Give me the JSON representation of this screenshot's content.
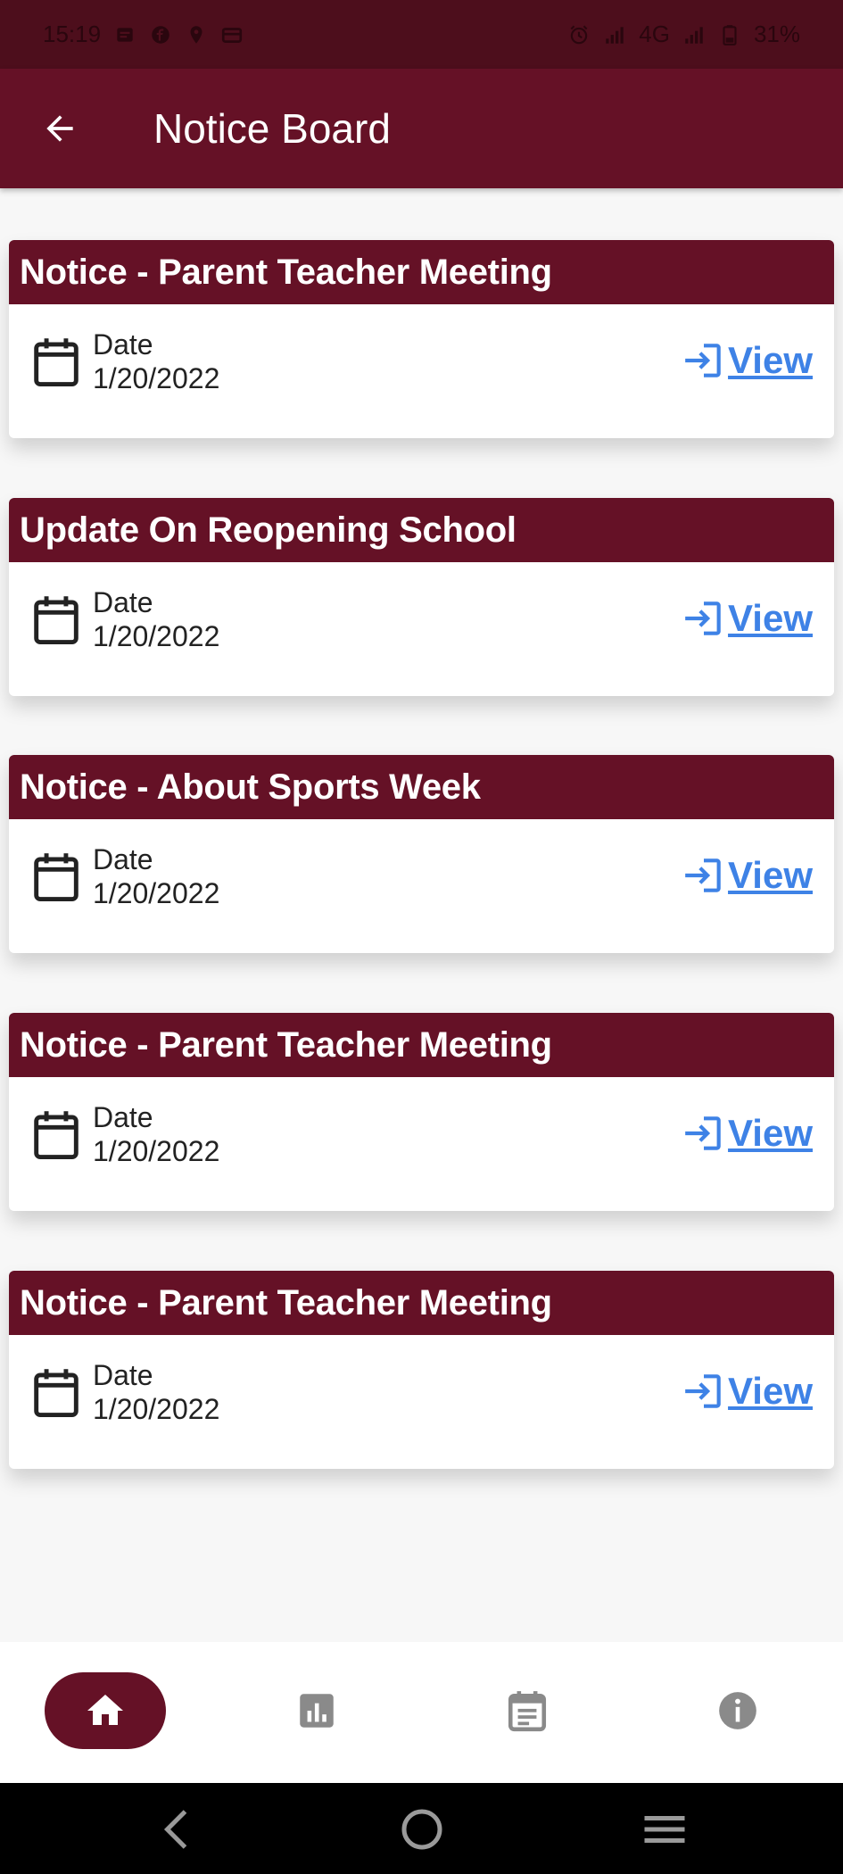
{
  "status_bar": {
    "time": "15:19",
    "battery": "31%",
    "network": "4G",
    "icons": [
      "notification-icon",
      "facebook-icon",
      "location-icon",
      "wallet-icon",
      "alarm-icon",
      "signal-icon",
      "battery-icon"
    ]
  },
  "app_bar": {
    "title": "Notice Board",
    "back_icon": "arrow-left-icon"
  },
  "notices": [
    {
      "title": "Notice - Parent Teacher Meeting",
      "date_label": "Date",
      "date": "1/20/2022",
      "view_label": "View"
    },
    {
      "title": "Update On Reopening School",
      "date_label": "Date",
      "date": "1/20/2022",
      "view_label": "View"
    },
    {
      "title": "Notice - About Sports Week",
      "date_label": "Date",
      "date": "1/20/2022",
      "view_label": "View"
    },
    {
      "title": "Notice - Parent Teacher Meeting",
      "date_label": "Date",
      "date": "1/20/2022",
      "view_label": "View"
    },
    {
      "title": "Notice - Parent Teacher Meeting",
      "date_label": "Date",
      "date": "1/20/2022",
      "view_label": "View"
    }
  ],
  "bottom_nav": {
    "items": [
      {
        "icon": "home-icon",
        "active": true
      },
      {
        "icon": "bar-chart-icon",
        "active": false
      },
      {
        "icon": "calendar-notes-icon",
        "active": false
      },
      {
        "icon": "info-icon",
        "active": false
      }
    ]
  },
  "system_nav": [
    "back-nav-icon",
    "home-nav-icon",
    "menu-nav-icon"
  ],
  "colors": {
    "primary": "#651126",
    "status_bar": "#4d0e1c",
    "link": "#3e82e6",
    "background": "#f7f7f7",
    "inactive_icon": "#8a8a8a"
  }
}
